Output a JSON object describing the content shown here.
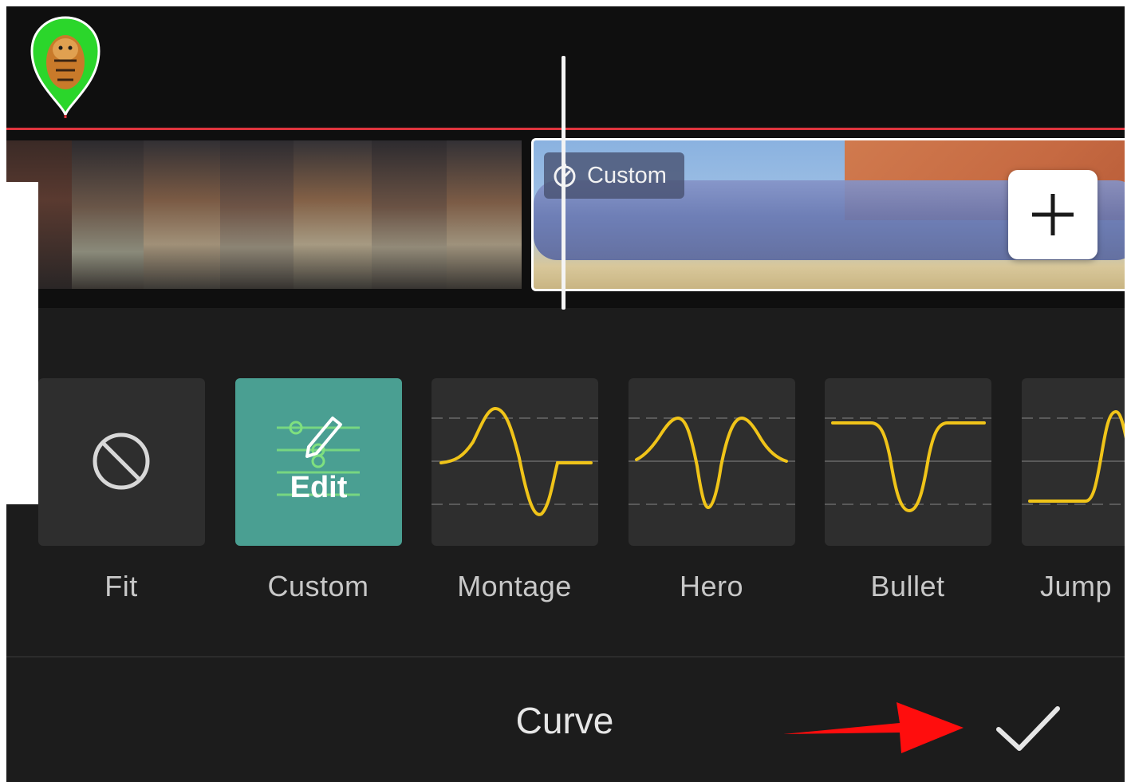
{
  "timeline": {
    "custom_tag_label": "Custom"
  },
  "options": {
    "fit": {
      "label": "Fit",
      "icon": "prohibited-icon"
    },
    "custom": {
      "label": "Custom",
      "edit_label": "Edit",
      "icon": "pencil-icon"
    },
    "montage": {
      "label": "Montage"
    },
    "hero": {
      "label": "Hero"
    },
    "bullet": {
      "label": "Bullet"
    },
    "jump": {
      "label": "Jump"
    }
  },
  "footer": {
    "title": "Curve",
    "confirm_icon": "checkmark-icon"
  },
  "colors": {
    "accent": "#4a9f92",
    "curve": "#f0c419",
    "marker": "#e0353e",
    "arrow": "#ff0d0d"
  }
}
